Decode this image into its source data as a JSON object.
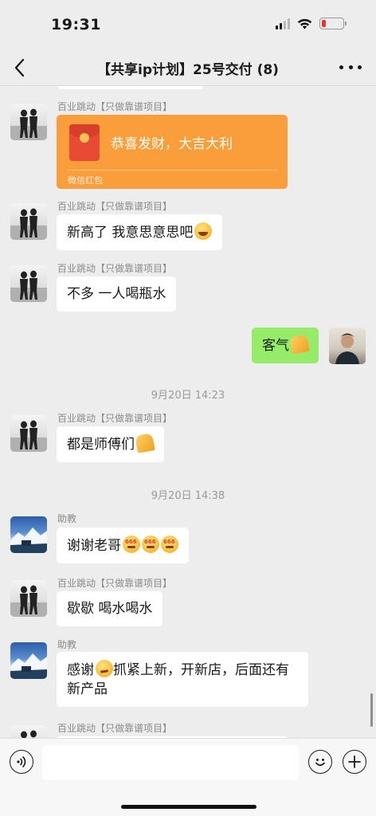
{
  "status": {
    "time": "19:31"
  },
  "nav": {
    "title": "【共享ip计划】25号交付 (8)"
  },
  "messages": [
    {
      "sender": "百业跳动【只做靠谱项目】",
      "redpacket_title": "恭喜发财，大吉大利",
      "redpacket_footer": "微信红包"
    },
    {
      "sender": "百业跳动【只做靠谱项目】",
      "text": "新高了 我意思意思吧"
    },
    {
      "sender": "百业跳动【只做靠谱项目】",
      "text": "不多 一人喝瓶水"
    },
    {
      "text": "客气"
    },
    {
      "timestamp": "9月20日 14:23"
    },
    {
      "sender": "百业跳动【只做靠谱项目】",
      "text": "都是师傅们"
    },
    {
      "timestamp": "9月20日 14:38"
    },
    {
      "sender": "助教",
      "text": "谢谢老哥"
    },
    {
      "sender": "百业跳动【只做靠谱项目】",
      "text": "歇歇 喝水喝水"
    },
    {
      "sender": "助教",
      "text_a": "感谢",
      "text_b": "抓紧上新，开新店，后面还有新产品"
    },
    {
      "sender": "百业跳动【只做靠谱项目】"
    }
  ],
  "input": {
    "placeholder": ""
  },
  "colors": {
    "redpacket": "#fa9d3b",
    "my_bubble": "#95ec69",
    "background": "#ededed",
    "battery_low": "#f0302f"
  },
  "icons": [
    "back-icon",
    "more-icon",
    "voice-icon",
    "emoji-icon",
    "plus-icon"
  ]
}
